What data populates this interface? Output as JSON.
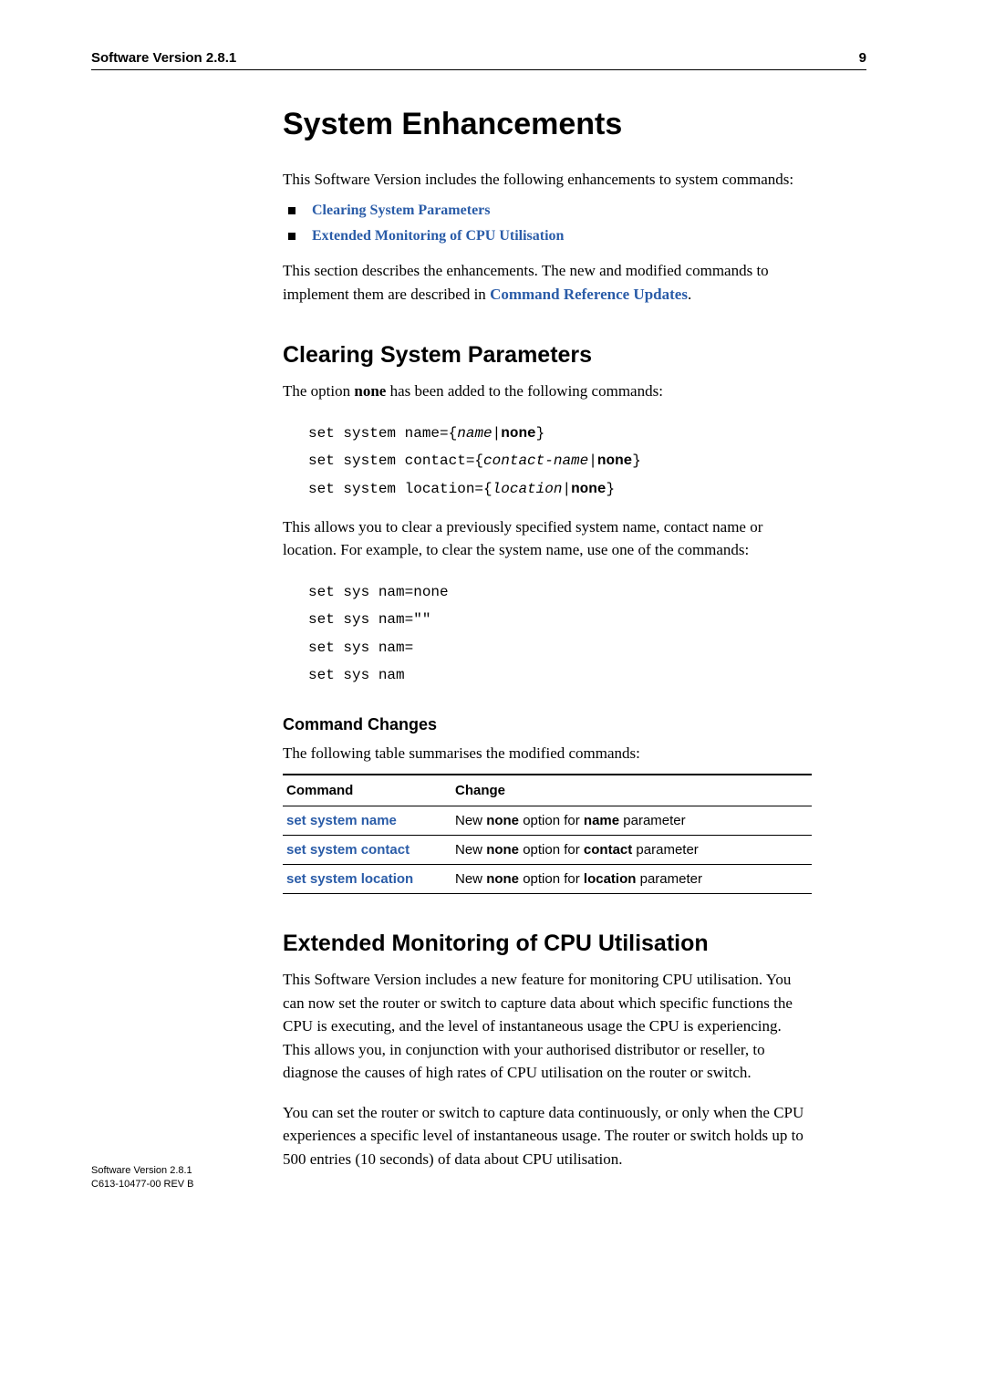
{
  "header": {
    "left": "Software Version 2.8.1",
    "right": "9"
  },
  "title": "System Enhancements",
  "intro": "This Software Version includes the following enhancements to system commands:",
  "toc": {
    "items": [
      "Clearing System Parameters",
      "Extended Monitoring of CPU Utilisation"
    ]
  },
  "intro_after_list_pre": "This section describes the enhancements. The new and modified commands to implement them are described in ",
  "intro_after_list_link": "Command Reference Updates",
  "intro_after_list_post": ".",
  "section_csp": {
    "title": "Clearing System Parameters",
    "lead_pre": "The option ",
    "lead_bold": "none",
    "lead_post": " has been added to the following commands:",
    "code1": {
      "l1_a": "set system name={",
      "l1_i": "name",
      "l1_b": "|",
      "l1_c": "none",
      "l1_d": "}",
      "l2_a": "set system contact={",
      "l2_i": "contact-name",
      "l2_b": "|",
      "l2_c": "none",
      "l2_d": "}",
      "l3_a": "set system location={",
      "l3_i": "location",
      "l3_b": "|",
      "l3_c": "none",
      "l3_d": "}"
    },
    "mid": "This allows you to clear a previously specified system name, contact name or location. For example, to clear the system name, use one of the commands:",
    "code2": {
      "l1": "set sys nam=none",
      "l2": "set sys nam=\"\"",
      "l3": "set sys nam=",
      "l4": "set sys nam"
    },
    "subsection_title": "Command Changes",
    "subsection_intro": "The following table summarises the modified commands:",
    "table": {
      "head": {
        "c1": "Command",
        "c2": "Change"
      },
      "rows": [
        {
          "cmd": "set system name",
          "ch_a": "New ",
          "ch_b": "none",
          "ch_c": " option for ",
          "ch_d": "name",
          "ch_e": " parameter"
        },
        {
          "cmd": "set system contact",
          "ch_a": "New ",
          "ch_b": "none",
          "ch_c": " option for ",
          "ch_d": "contact",
          "ch_e": " parameter"
        },
        {
          "cmd": "set system location",
          "ch_a": "New ",
          "ch_b": "none",
          "ch_c": " option for ",
          "ch_d": "location",
          "ch_e": " parameter"
        }
      ]
    }
  },
  "section_cpu": {
    "title": "Extended Monitoring of CPU Utilisation",
    "p1": "This Software Version includes a new feature for monitoring CPU utilisation. You can now set the router or switch to capture data about which specific functions the CPU is executing, and the level of instantaneous usage the CPU is experiencing. This allows you, in conjunction with your authorised distributor or reseller, to diagnose the causes of high rates of CPU utilisation on the router or switch.",
    "p2": "You can set the router or switch to capture data continuously, or only when the CPU experiences a specific level of instantaneous usage. The router or switch holds up to 500 entries (10 seconds) of data about CPU utilisation."
  },
  "footer": {
    "l1": "Software Version 2.8.1",
    "l2": "C613-10477-00 REV B"
  }
}
